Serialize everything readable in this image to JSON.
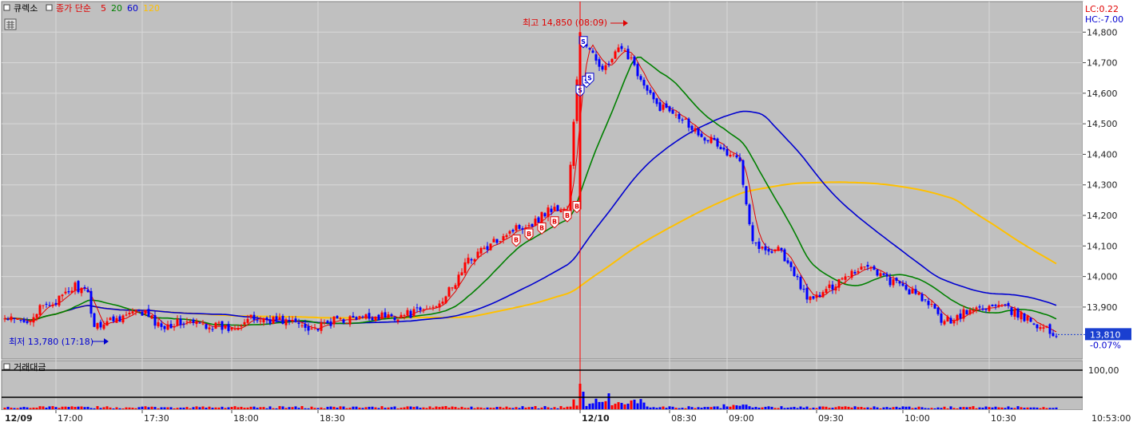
{
  "legend": {
    "name": "큐렉소",
    "ma_prefix": "종가 단순",
    "periods": [
      {
        "label": "5",
        "color": "#e00000"
      },
      {
        "label": "20",
        "color": "#008000"
      },
      {
        "label": "60",
        "color": "#0000d0"
      },
      {
        "label": "120",
        "color": "#ffc000"
      }
    ]
  },
  "top_right": {
    "lc": "LC:0.22",
    "hc": "HC:-7.00"
  },
  "annotations": {
    "high": "최고 14,850 (08:09)",
    "low": "최저 13,780 (17:18)"
  },
  "current": {
    "price": "13,810",
    "change": "-0.07%"
  },
  "volume": {
    "title": "거래대금",
    "scale_label": "100,00"
  },
  "time_axis": {
    "labels": [
      "12/09",
      "17:00",
      "17:30",
      "18:00",
      "18:30",
      "12/10",
      "08:30",
      "09:00",
      "09:30",
      "10:00",
      "10:30"
    ],
    "corner": "10:53:00"
  },
  "chart_data": {
    "type": "candlestick",
    "ylim": [
      13730,
      14900
    ],
    "y_ticks": [
      "14,800",
      "14,700",
      "14,600",
      "14,500",
      "14,400",
      "14,300",
      "14,200",
      "14,100",
      "14,000",
      "13,900"
    ],
    "y_tick_values": [
      14800,
      14700,
      14600,
      14500,
      14400,
      14300,
      14200,
      14100,
      14000,
      13900
    ],
    "close_anchors": [
      [
        0,
        13860
      ],
      [
        6,
        13850
      ],
      [
        12,
        13900
      ],
      [
        18,
        13930
      ],
      [
        22,
        13970
      ],
      [
        26,
        13940
      ],
      [
        28,
        13840
      ],
      [
        34,
        13860
      ],
      [
        40,
        13880
      ],
      [
        44,
        13880
      ],
      [
        48,
        13840
      ],
      [
        56,
        13850
      ],
      [
        64,
        13840
      ],
      [
        70,
        13830
      ],
      [
        76,
        13860
      ],
      [
        84,
        13860
      ],
      [
        90,
        13850
      ],
      [
        98,
        13830
      ],
      [
        104,
        13860
      ],
      [
        110,
        13860
      ],
      [
        116,
        13870
      ],
      [
        122,
        13870
      ],
      [
        128,
        13880
      ],
      [
        134,
        13900
      ],
      [
        140,
        13960
      ],
      [
        144,
        14040
      ],
      [
        148,
        14080
      ],
      [
        152,
        14100
      ],
      [
        156,
        14140
      ],
      [
        160,
        14160
      ],
      [
        166,
        14180
      ],
      [
        170,
        14220
      ],
      [
        176,
        14220
      ],
      [
        180,
        14780
      ],
      [
        184,
        14720
      ],
      [
        188,
        14680
      ],
      [
        192,
        14740
      ],
      [
        196,
        14720
      ],
      [
        200,
        14620
      ],
      [
        204,
        14560
      ],
      [
        210,
        14540
      ],
      [
        216,
        14480
      ],
      [
        222,
        14440
      ],
      [
        226,
        14400
      ],
      [
        230,
        14380
      ],
      [
        234,
        14120
      ],
      [
        238,
        14080
      ],
      [
        242,
        14100
      ],
      [
        246,
        14020
      ],
      [
        252,
        13920
      ],
      [
        258,
        13960
      ],
      [
        262,
        14000
      ],
      [
        266,
        14020
      ],
      [
        270,
        14040
      ],
      [
        276,
        13990
      ],
      [
        282,
        13960
      ],
      [
        288,
        13920
      ],
      [
        294,
        13850
      ],
      [
        300,
        13880
      ],
      [
        306,
        13900
      ],
      [
        312,
        13900
      ],
      [
        318,
        13870
      ],
      [
        324,
        13840
      ],
      [
        328,
        13810
      ]
    ],
    "ma_periods": [
      5,
      20,
      60,
      120
    ],
    "signals": {
      "buy": [
        [
          160,
          14120
        ],
        [
          164,
          14140
        ],
        [
          168,
          14160
        ],
        [
          172,
          14180
        ],
        [
          176,
          14200
        ],
        [
          179,
          14230
        ]
      ],
      "sell": [
        [
          180,
          14610
        ],
        [
          181,
          14770
        ],
        [
          182,
          14640
        ],
        [
          183,
          14650
        ]
      ]
    },
    "high": {
      "value": 14850,
      "time": "08:09"
    },
    "low": {
      "value": 13780,
      "time": "17:18"
    },
    "last": 13810
  }
}
